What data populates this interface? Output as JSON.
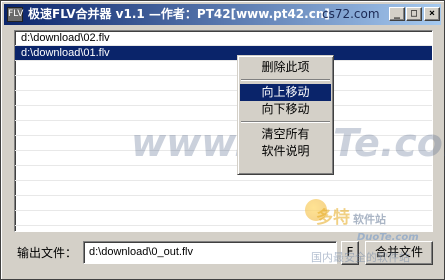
{
  "window": {
    "title": "极速FLV合并器 v1.1 —作者：PT42[www.pt42.cn]",
    "title_watermark": "cs72.com",
    "app_icon_label": "FLV",
    "controls": {
      "minimize": "_",
      "maximize": "□",
      "close": "×"
    }
  },
  "file_list": {
    "items": [
      {
        "path": "d:\\download\\02.flv",
        "selected": false
      },
      {
        "path": "d:\\download\\01.flv",
        "selected": true
      }
    ]
  },
  "context_menu": {
    "items": [
      {
        "label": "删除此项"
      },
      {
        "label": "向上移动",
        "highlighted": true
      },
      {
        "label": "向下移动"
      },
      {
        "label": "清空所有"
      },
      {
        "label": "软件说明"
      }
    ]
  },
  "output": {
    "label": "输出文件：",
    "value": "d:\\download\\0_out.flv",
    "browse_label": "F",
    "merge_label": "合并文件"
  },
  "watermarks": {
    "center": "www.DuoTe.com",
    "logo": "多特",
    "logo_sub": "软件站",
    "duote_small": "DuoTe.com",
    "bottom": "国内最安全的软件站"
  }
}
